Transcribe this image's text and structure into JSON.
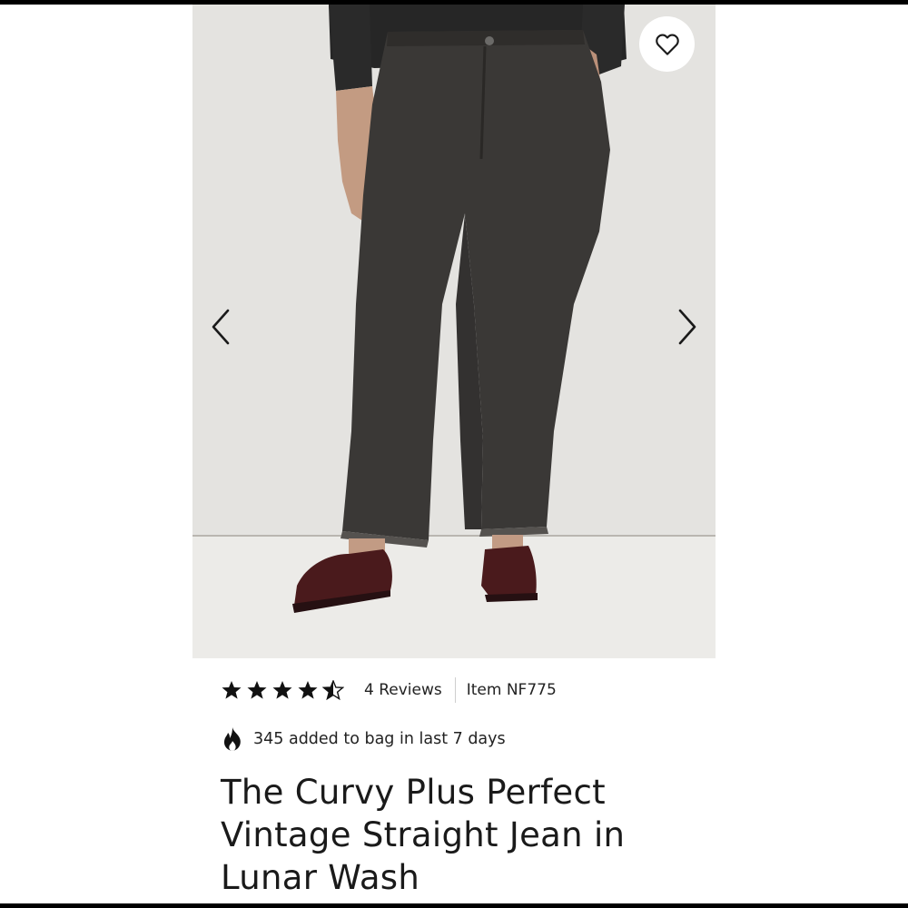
{
  "product": {
    "favorite_label": "favorite",
    "rating": {
      "stars": 4.5,
      "max": 5,
      "reviews_text": "4 Reviews",
      "item_text": "Item NF775"
    },
    "social_proof_text": "345 added to bag in last 7 days",
    "title": "The Curvy Plus Perfect Vintage Straight Jean in Lunar Wash"
  },
  "icons": {
    "favorite": "heart-icon",
    "previous": "chevron-left-icon",
    "next": "chevron-right-icon",
    "trending": "flame-icon",
    "star": "star-icon"
  },
  "colors": {
    "text": "#1a1a1a",
    "photo_background": "#e3e2df",
    "denim": "#3a3836",
    "shoes": "#4a1a1c"
  }
}
